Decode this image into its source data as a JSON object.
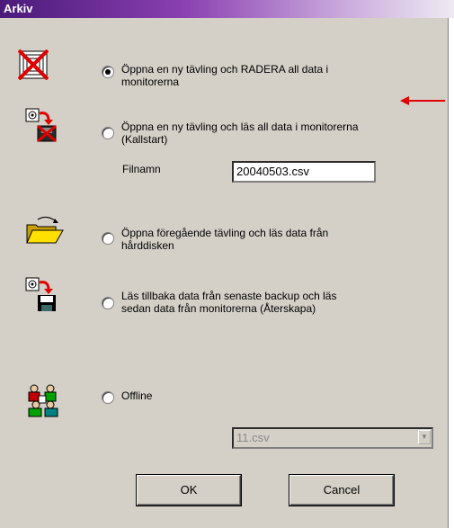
{
  "window": {
    "title": "Arkiv"
  },
  "options": [
    {
      "label_line1": "Öppna en ny tävling och RADERA all data i",
      "label_line2": "monitorerna",
      "icon": "monitor-delete-icon",
      "checked": true
    },
    {
      "label_line1": "Öppna en ny tävling och läs all data i monitorerna",
      "label_line2": "(Kallstart)",
      "icon": "cold-start-icon",
      "checked": false
    },
    {
      "label_line1": "Öppna föregående tävling och läs data från",
      "label_line2": "hårddisken",
      "icon": "open-folder-icon",
      "checked": false
    },
    {
      "label_line1": "Läs tillbaka data från senaste backup och läs",
      "label_line2": "sedan data från monitorerna (Återskapa)",
      "icon": "restore-backup-icon",
      "checked": false
    },
    {
      "label_line1": "Offline",
      "label_line2": "",
      "icon": "people-group-icon",
      "checked": false
    }
  ],
  "filename": {
    "label": "Filnamn",
    "value": "20040503.csv"
  },
  "offline_file": {
    "value": "11.csv"
  },
  "buttons": {
    "ok": "OK",
    "cancel": "Cancel"
  },
  "colors": {
    "titlebar_start": "#4a1a7a",
    "face": "#d4d0c8",
    "arrow": "#e00000"
  }
}
